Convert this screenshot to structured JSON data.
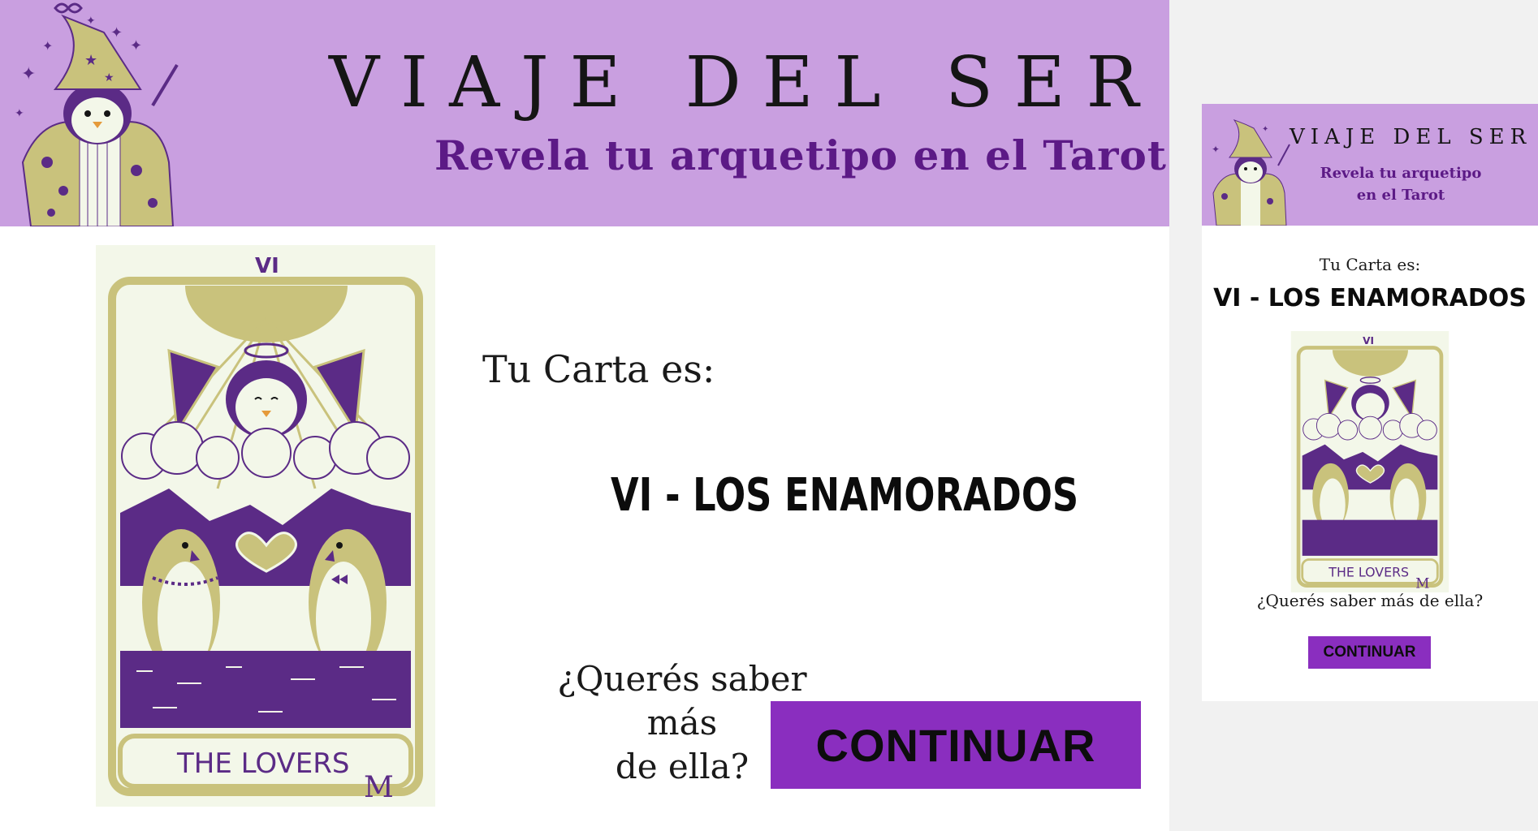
{
  "colors": {
    "banner": "#c99fe0",
    "subtitle": "#5c1a86",
    "button": "#8a2ebf",
    "card_olive": "#c9c27c",
    "card_purple": "#5b2b86",
    "card_cream": "#f3f7e9"
  },
  "header": {
    "title": "VIAJE DEL SER",
    "subtitle": "Revela tu arquetipo  en el Tarot",
    "subtitle_line1": "Revela tu arquetipo",
    "subtitle_line2": "en el Tarot",
    "logo_icon": "penguin-wizard-icon"
  },
  "result": {
    "label": "Tu Carta es:",
    "card_name": "VI - LOS ENAMORADOS",
    "question": "¿Querés saber más de ella?",
    "question_line1": "¿Querés saber más",
    "question_line2": "de ella?",
    "button_label": "CONTINUAR"
  },
  "card": {
    "numeral": "VI",
    "caption": "THE LOVERS",
    "signature": "M"
  }
}
